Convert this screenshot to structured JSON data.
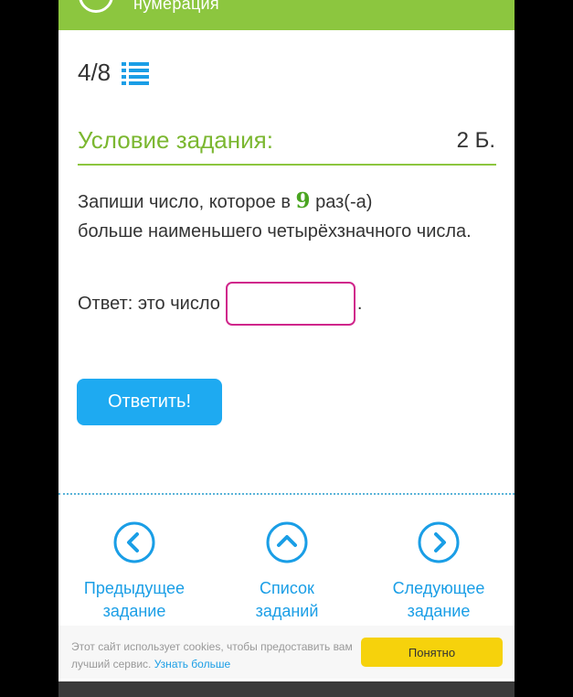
{
  "header": {
    "title": "нумерация"
  },
  "progress": {
    "counter": "4/8"
  },
  "task": {
    "section_title": "Условие задания:",
    "points": "2 Б.",
    "text_before": "Запиши число, которое в ",
    "number": "9",
    "text_after": " раз(-а)",
    "text_line2": "больше наименьшего четырёхзначного числа.",
    "answer_label": "Ответ: это число",
    "answer_value": "",
    "answer_suffix": ".",
    "submit_label": "Ответить!"
  },
  "navigation": {
    "prev": {
      "line1": "Предыдущее",
      "line2": "задание"
    },
    "list": {
      "line1": "Список",
      "line2": "заданий"
    },
    "next": {
      "line1": "Следующее",
      "line2": "задание"
    }
  },
  "cookie": {
    "text": "Этот сайт использует cookies, чтобы предоставить вам лучший сервис.",
    "link": "Узнать больше",
    "accept": "Понятно"
  },
  "colors": {
    "header_green": "#8cc63f",
    "accent_blue": "#1eaaf1",
    "input_border": "#d0268b",
    "cookie_button": "#f6d20c"
  }
}
